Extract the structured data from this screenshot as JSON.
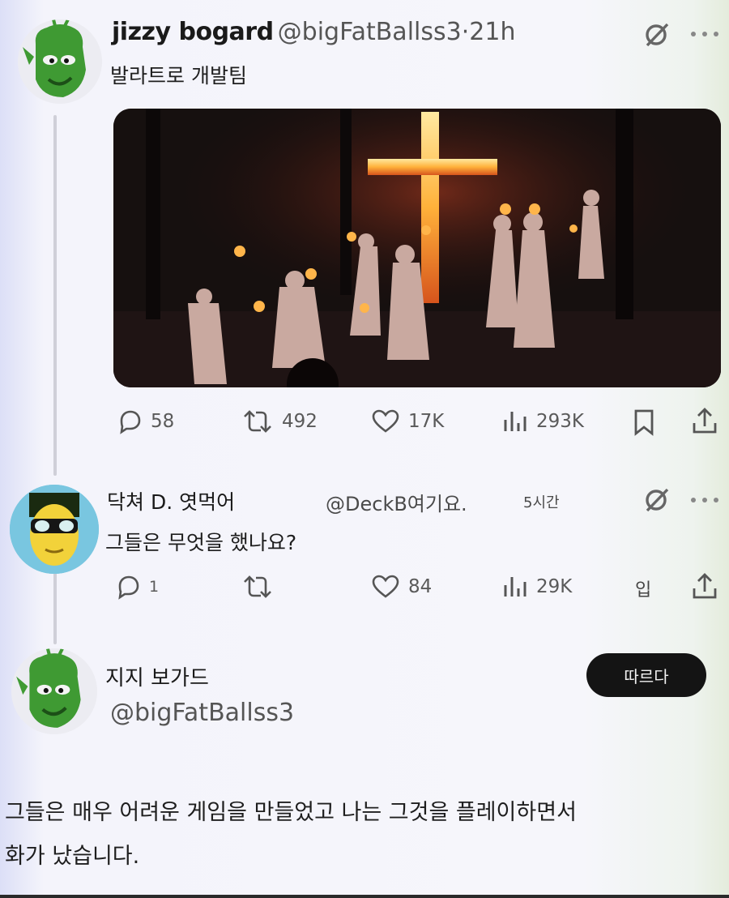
{
  "tweet": {
    "name": "jizzy bogard",
    "handle": "@bigFatBallss3",
    "separator": "·",
    "time": "21h",
    "text": "발라트로 개발팀",
    "stats": {
      "replies": "58",
      "retweets": "492",
      "likes": "17K",
      "views": "293K"
    }
  },
  "reply": {
    "name": "닥쳐 D. 엿먹어",
    "handle": "@DeckB여기요.",
    "time": "5시간",
    "text": "그들은 무엇을 했나요?",
    "stats": {
      "replies": "1",
      "likes": "84",
      "views": "29K"
    },
    "extra_label": "입"
  },
  "profile": {
    "name": "지지 보가드",
    "handle": "@bigFatBallss3",
    "follow_label": "따르다"
  },
  "quote": {
    "line1": "그들은 매우 어려운 게임을 만들었고 나는 그것을 플레이하면서",
    "line2": "화가 났습니다."
  },
  "icons": [
    "grok-icon",
    "more-icon",
    "reply-icon",
    "retweet-icon",
    "like-icon",
    "views-icon",
    "bookmark-icon",
    "share-icon"
  ]
}
